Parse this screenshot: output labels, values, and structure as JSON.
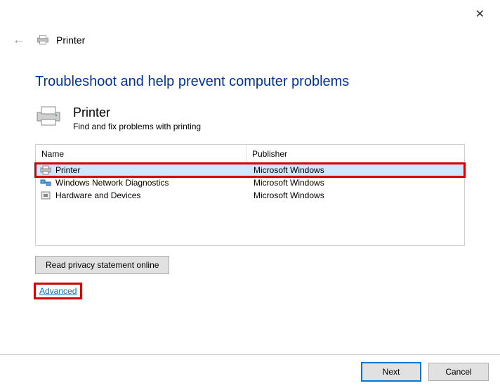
{
  "window": {
    "title": "Printer"
  },
  "heading": "Troubleshoot and help prevent computer problems",
  "section": {
    "title": "Printer",
    "subtitle": "Find and fix problems with printing"
  },
  "table": {
    "headers": {
      "name": "Name",
      "publisher": "Publisher"
    },
    "rows": [
      {
        "name": "Printer",
        "publisher": "Microsoft Windows"
      },
      {
        "name": "Windows Network Diagnostics",
        "publisher": "Microsoft Windows"
      },
      {
        "name": "Hardware and Devices",
        "publisher": "Microsoft Windows"
      }
    ]
  },
  "buttons": {
    "privacy": "Read privacy statement online",
    "advanced": "Advanced",
    "next": "Next",
    "cancel": "Cancel"
  }
}
